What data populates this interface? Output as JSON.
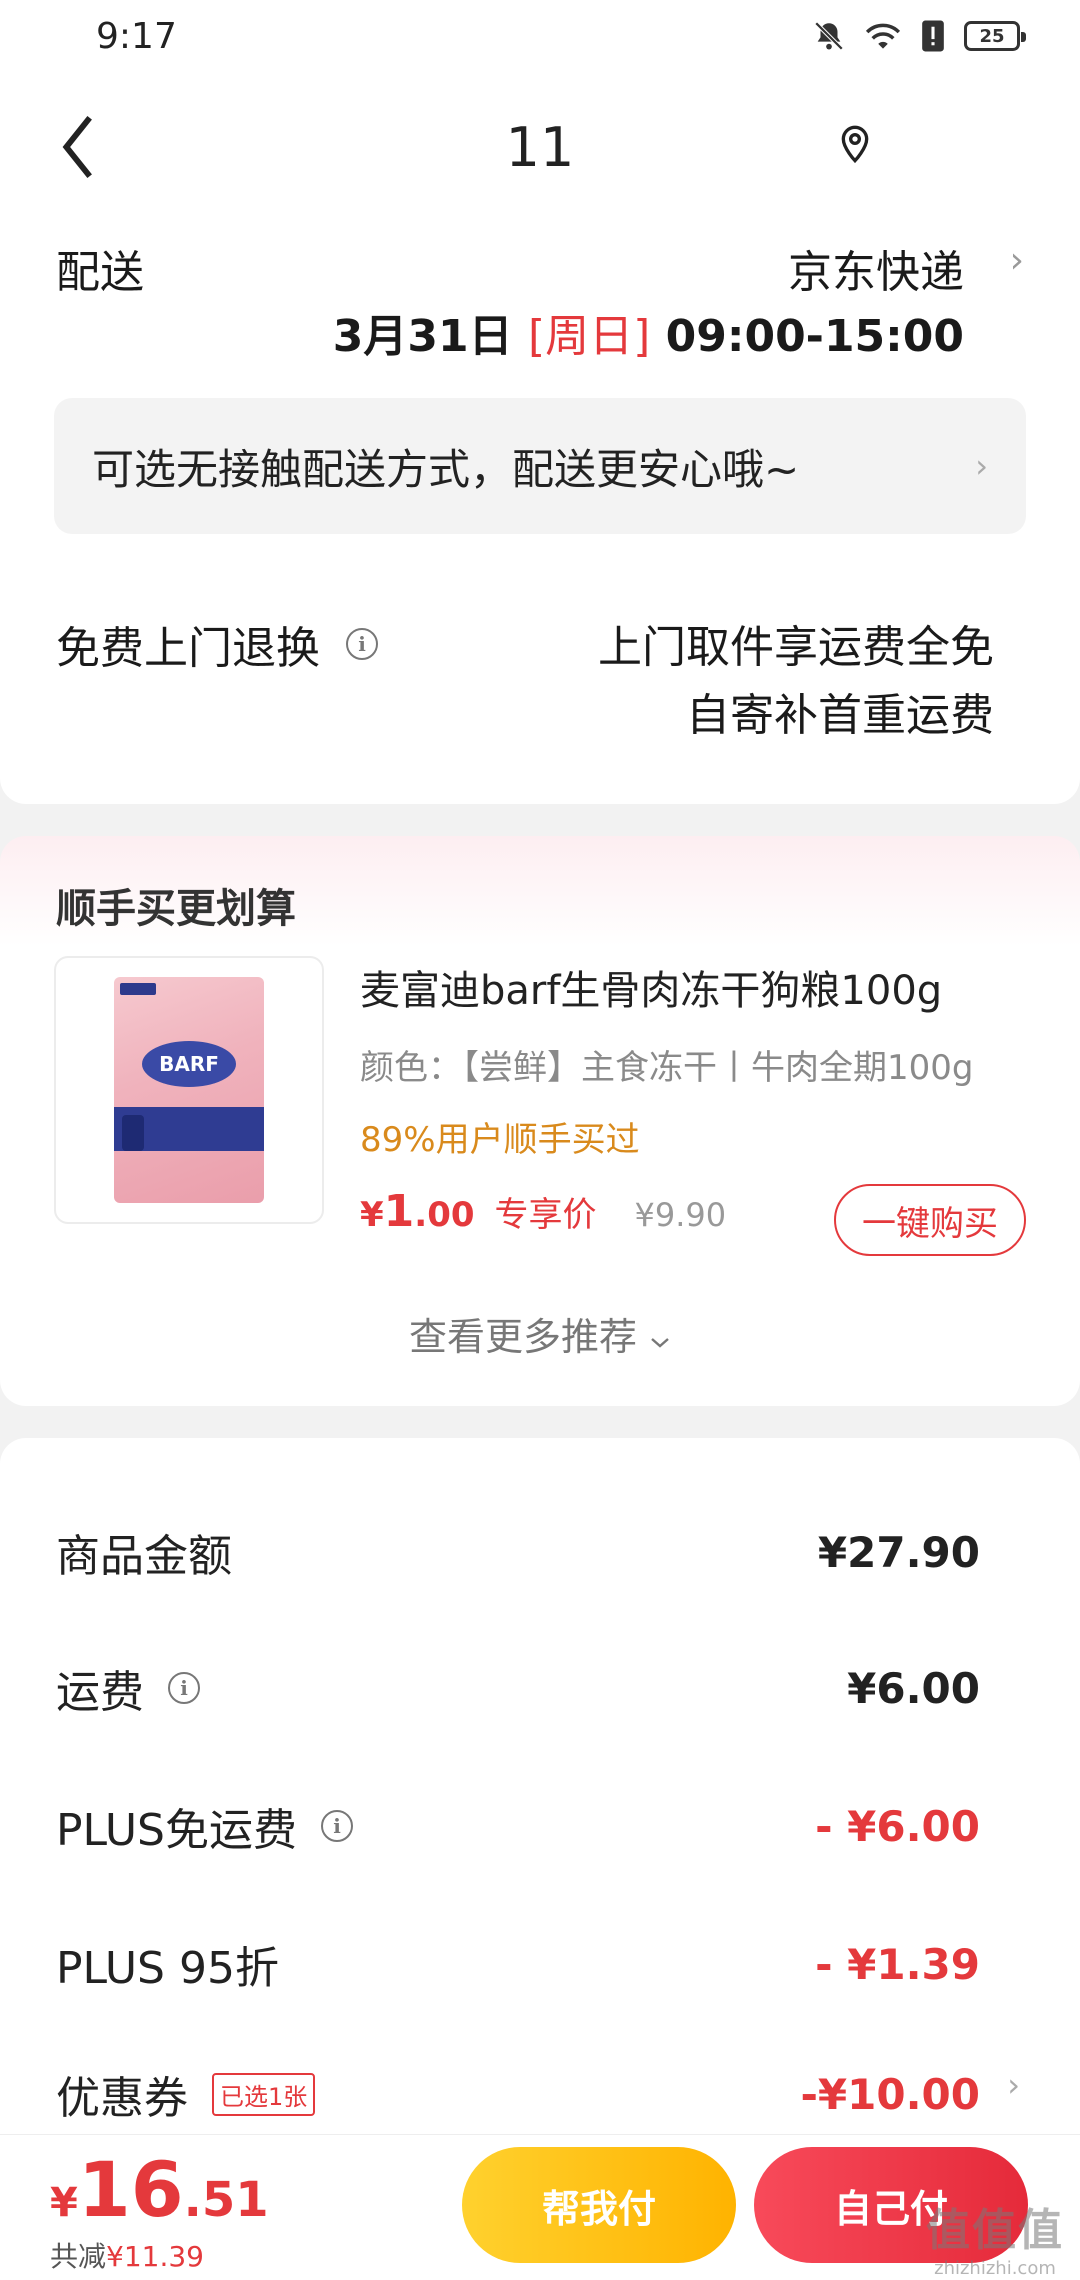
{
  "status_bar": {
    "time": "9:17",
    "battery": "25",
    "icons": [
      "bell-muted-icon",
      "wifi-icon",
      "alert-icon",
      "battery-icon"
    ]
  },
  "nav": {
    "title": "11",
    "icons": [
      "back-icon",
      "location-icon"
    ]
  },
  "delivery": {
    "label": "配送",
    "carrier": "京东快递",
    "chevron": "›",
    "date": "3月31日",
    "day": "[周日]",
    "time_window": "09:00-15:00"
  },
  "contactless": {
    "text": "可选无接触配送方式，配送更安心哦~",
    "chevron": "›"
  },
  "returns": {
    "label": "免费上门退换",
    "line1": "上门取件享运费全免",
    "line2": "自寄补首重运费"
  },
  "addon": {
    "title": "顺手买更划算",
    "product": {
      "name": "麦富迪barf生骨肉冻干狗粮100g",
      "spec": "颜色：【尝鲜】主食冻干丨牛肉全期100g",
      "social_proof": "89%用户顺手买过",
      "price_symbol": "¥",
      "price_int": "1",
      "price_dec": ".00",
      "price_tag": "专享价",
      "original_price": "¥9.90",
      "buy_label": "一键购买",
      "image_text": "BARF"
    },
    "more_label": "查看更多推荐"
  },
  "fees": {
    "goods": {
      "label": "商品金额",
      "value": "¥27.90"
    },
    "shipping": {
      "label": "运费",
      "value": "¥6.00"
    },
    "plus_free_shipping": {
      "label": "PLUS免运费",
      "value": "- ¥6.00"
    },
    "plus_discount": {
      "label": "PLUS 95折",
      "value": "- ¥1.39"
    },
    "coupon": {
      "label": "优惠券",
      "badge": "已选1张",
      "value": "-¥10.00",
      "chevron": "›"
    }
  },
  "footer": {
    "total_symbol": "¥",
    "total_int": "16",
    "total_dec": ".51",
    "saved_label": "共减",
    "saved_amount": "¥11.39",
    "helper_pay": "帮我付",
    "self_pay": "自己付",
    "watermark": "值值值",
    "watermark_url": "zhizhizhi.com"
  },
  "colors": {
    "accent_red": "#e4393c",
    "orange_text": "#d98a1c",
    "helper_button": "#ffc107",
    "self_button": "#ef3a49"
  }
}
